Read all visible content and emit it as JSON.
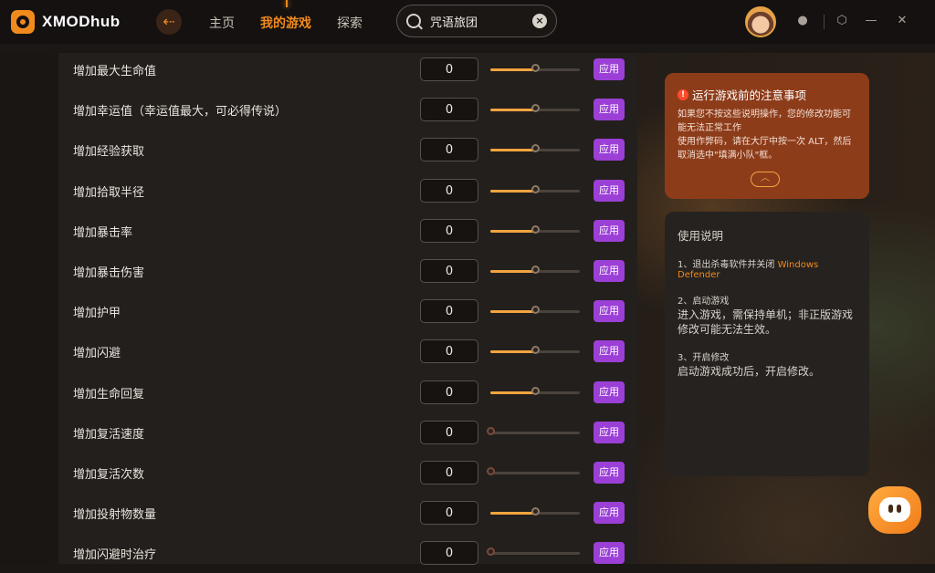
{
  "app": {
    "brand": "XMODhub",
    "back_icon": "back-arrow-icon"
  },
  "nav": {
    "items": [
      "主页",
      "我的游戏",
      "探索"
    ],
    "active": "我的游戏"
  },
  "search": {
    "value": "咒语旅团",
    "icon": "search-icon",
    "clear_icon": "close-icon"
  },
  "header_icons": [
    "avatar",
    "notification-icon",
    "settings-icon",
    "minimize-icon",
    "close-icon"
  ],
  "mods": {
    "apply_label": "应用",
    "rows": [
      {
        "label": "增加最大生命值",
        "value": "0",
        "level": 0.5
      },
      {
        "label": "增加幸运值（幸运值最大，可必得传说）",
        "value": "0",
        "level": 0.5
      },
      {
        "label": "增加经验获取",
        "value": "0",
        "level": 0.5
      },
      {
        "label": "增加拾取半径",
        "value": "0",
        "level": 0.5
      },
      {
        "label": "增加暴击率",
        "value": "0",
        "level": 0.5
      },
      {
        "label": "增加暴击伤害",
        "value": "0",
        "level": 0.5
      },
      {
        "label": "增加护甲",
        "value": "0",
        "level": 0.5
      },
      {
        "label": "增加闪避",
        "value": "0",
        "level": 0.5
      },
      {
        "label": "增加生命回复",
        "value": "0",
        "level": 0.5
      },
      {
        "label": "增加复活速度",
        "value": "0",
        "level": 0
      },
      {
        "label": "增加复活次数",
        "value": "0",
        "level": 0
      },
      {
        "label": "增加投射物数量",
        "value": "0",
        "level": 0.5
      },
      {
        "label": "增加闪避时治疗",
        "value": "0",
        "level": 0
      }
    ]
  },
  "notice": {
    "title": "运行游戏前的注意事项",
    "lines": [
      "如果您不按这些说明操作，您的修改功能可能无法正常工作",
      "使用作弊码，请在大厅中按一次 ALT，然后取消选中\"填满小队\"框。"
    ],
    "collapse_icon": "chevron-up-icon"
  },
  "instructions": {
    "title": "使用说明",
    "steps": [
      {
        "head": "1、退出杀毒软件并关闭",
        "highlight": "Windows Defender",
        "text": ""
      },
      {
        "head": "2、启动游戏",
        "highlight": "",
        "text": "进入游戏，需保持单机；非正版游戏修改可能无法生效。"
      },
      {
        "head": "3、开启修改",
        "highlight": "",
        "text": "启动游戏成功后，开启修改。"
      }
    ]
  },
  "colors": {
    "accent": "#f08a1c",
    "apply": "#9b3fd6",
    "notice_bg": "#8d3c1a",
    "slider_fill": "#f2a440"
  }
}
